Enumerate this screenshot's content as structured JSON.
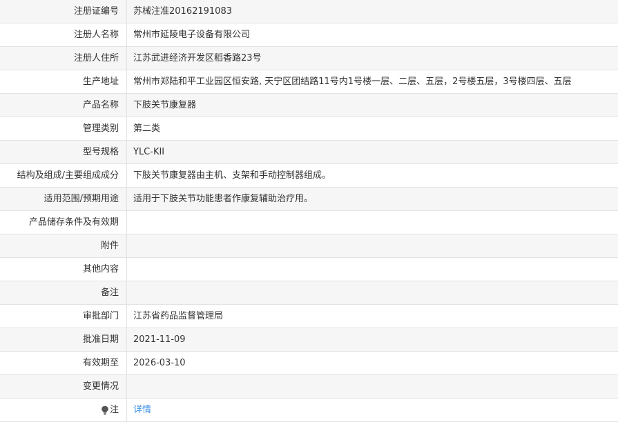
{
  "rows": [
    {
      "label": "注册证编号",
      "value": "苏械注准20162191083"
    },
    {
      "label": "注册人名称",
      "value": "常州市延陵电子设备有限公司"
    },
    {
      "label": "注册人住所",
      "value": "江苏武进经济开发区稻香路23号"
    },
    {
      "label": "生产地址",
      "value": "常州市郑陆和平工业园区恒安路, 天宁区团结路11号内1号楼一层、二层、五层，2号楼五层，3号楼四层、五层"
    },
    {
      "label": "产品名称",
      "value": "下肢关节康复器"
    },
    {
      "label": "管理类别",
      "value": "第二类"
    },
    {
      "label": "型号规格",
      "value": "YLC-KII"
    },
    {
      "label": "结构及组成/主要组成成分",
      "value": "下肢关节康复器由主机、支架和手动控制器组成。"
    },
    {
      "label": "适用范围/预期用途",
      "value": "适用于下肢关节功能患者作康复辅助治疗用。"
    },
    {
      "label": "产品储存条件及有效期",
      "value": ""
    },
    {
      "label": "附件",
      "value": ""
    },
    {
      "label": "其他内容",
      "value": ""
    },
    {
      "label": "备注",
      "value": ""
    },
    {
      "label": "审批部门",
      "value": "江苏省药品监督管理局"
    },
    {
      "label": "批准日期",
      "value": "2021-11-09"
    },
    {
      "label": "有效期至",
      "value": "2026-03-10"
    },
    {
      "label": "变更情况",
      "value": ""
    }
  ],
  "note": {
    "label": "注",
    "icon": "lightbulb-icon",
    "link_text": "详情"
  }
}
